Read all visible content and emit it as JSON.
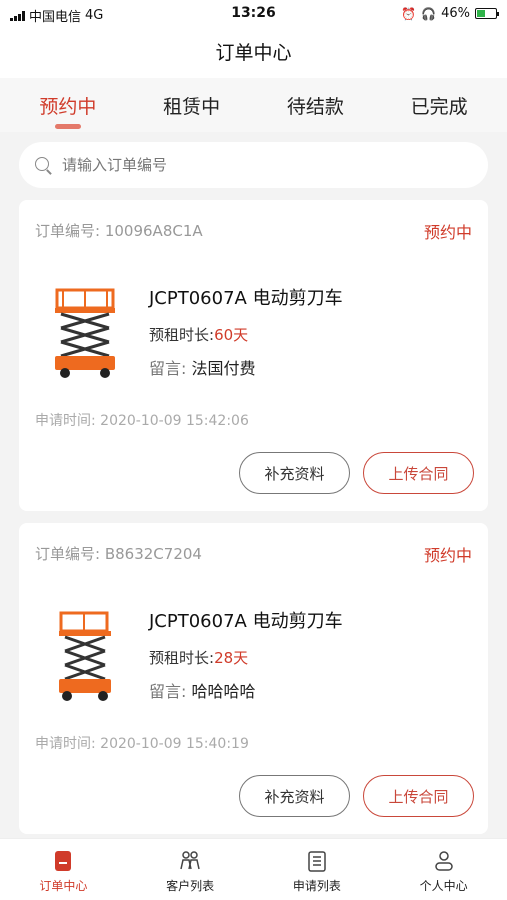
{
  "status_bar": {
    "carrier": "中国电信",
    "network": "4G",
    "time": "13:26",
    "battery": "46%",
    "battery_level": 0.46
  },
  "nav": {
    "title": "订单中心"
  },
  "tabs": [
    {
      "label": "预约中",
      "active": true
    },
    {
      "label": "租赁中",
      "active": false
    },
    {
      "label": "待结款",
      "active": false
    },
    {
      "label": "已完成",
      "active": false
    }
  ],
  "search": {
    "placeholder": "请输入订单编号"
  },
  "orders": [
    {
      "order_label": "订单编号:",
      "order_no": "10096A8C1A",
      "status": "预约中",
      "title": "JCPT0607A 电动剪刀车",
      "duration_label": "预租时长:",
      "duration_value": "60天",
      "message_label": "留言:",
      "message_value": "法国付费",
      "applied_label": "申请时间:",
      "applied_time": "2020-10-09 15:42:06",
      "btn_supplement": "补充资料",
      "btn_upload": "上传合同"
    },
    {
      "order_label": "订单编号:",
      "order_no": "B8632C7204",
      "status": "预约中",
      "title": "JCPT0607A 电动剪刀车",
      "duration_label": "预租时长:",
      "duration_value": "28天",
      "message_label": "留言:",
      "message_value": "哈哈哈哈",
      "applied_label": "申请时间:",
      "applied_time": "2020-10-09 15:40:19",
      "btn_supplement": "补充资料",
      "btn_upload": "上传合同"
    }
  ],
  "bottom_nav": [
    {
      "label": "订单中心",
      "icon": "order-center-icon",
      "active": true
    },
    {
      "label": "客户列表",
      "icon": "customers-icon",
      "active": false
    },
    {
      "label": "申请列表",
      "icon": "apply-list-icon",
      "active": false
    },
    {
      "label": "个人中心",
      "icon": "profile-icon",
      "active": false
    }
  ],
  "colors": {
    "accent": "#d03b2a",
    "machine_orange": "#ee6a1f"
  }
}
